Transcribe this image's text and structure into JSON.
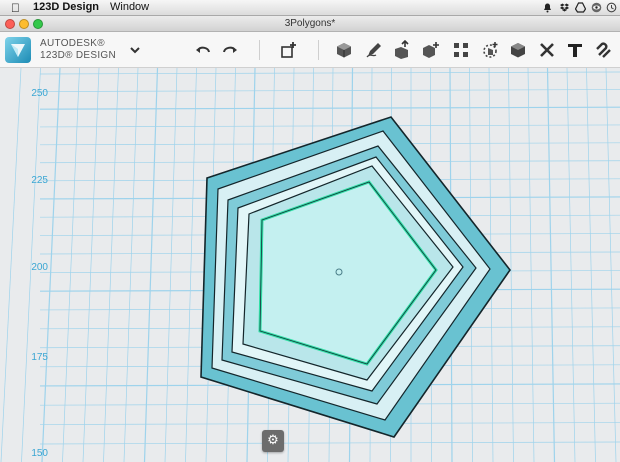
{
  "menubar": {
    "apple_icon": "apple-logo-icon",
    "app_name": "123D Design",
    "menu_window": "Window",
    "tray_icons": [
      "notification-icon",
      "dropbox-icon",
      "drive-icon",
      "eye-icon",
      "time-machine-icon"
    ]
  },
  "window": {
    "title": "3Polygons*",
    "traffic_colors": [
      "#fc5f57",
      "#fdbc2e",
      "#34c84a"
    ]
  },
  "toolbar": {
    "brand_line1": "AUTODESK®",
    "brand_line2": "123D® DESIGN",
    "app_menu_icon": "chevron-down-icon",
    "buttons": [
      {
        "name": "undo-button",
        "icon": "undo-icon"
      },
      {
        "name": "redo-button",
        "icon": "redo-icon"
      },
      {
        "name": "import-button",
        "icon": "box-plus-icon"
      },
      {
        "name": "primitives-button",
        "icon": "cube-icon"
      },
      {
        "name": "sketch-button",
        "icon": "pencil-icon"
      },
      {
        "name": "construct-button",
        "icon": "cube-arrow-icon"
      },
      {
        "name": "modify-button",
        "icon": "cube-edit-icon"
      },
      {
        "name": "pattern-button",
        "icon": "grid-icon"
      },
      {
        "name": "group-button",
        "icon": "group-icon"
      },
      {
        "name": "combine-button",
        "icon": "combine-icon"
      },
      {
        "name": "measure-button",
        "icon": "measure-icon"
      },
      {
        "name": "text-button",
        "icon": "text-icon"
      },
      {
        "name": "snap-button",
        "icon": "magnet-icon"
      }
    ]
  },
  "viewport": {
    "axis_labels": [
      "250",
      "225",
      "200",
      "175",
      "150"
    ],
    "grid_color": "#9ed3ec",
    "shape_fill": "#69c2d1",
    "selection_color": "#31e0a6",
    "settings_icon": "gear-icon"
  }
}
